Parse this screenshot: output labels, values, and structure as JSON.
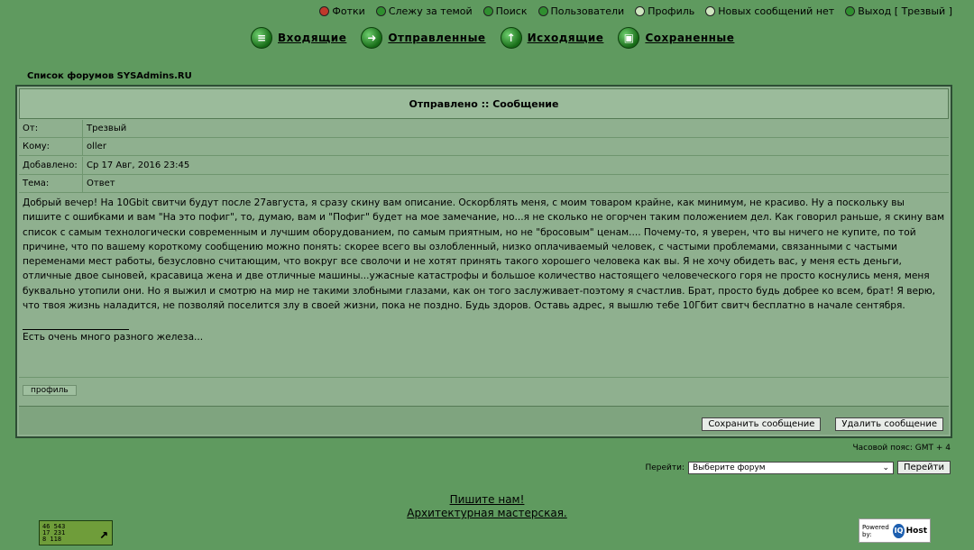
{
  "topnav": [
    {
      "name": "photos",
      "label": "Фотки",
      "color": "red"
    },
    {
      "name": "watched",
      "label": "Слежу за темой",
      "color": "green"
    },
    {
      "name": "search",
      "label": "Поиск",
      "color": "green"
    },
    {
      "name": "users",
      "label": "Пользователи",
      "color": "green"
    },
    {
      "name": "profile",
      "label": "Профиль",
      "color": "lt"
    },
    {
      "name": "new-messages",
      "label": "Новых сообщений нет",
      "color": "lt"
    },
    {
      "name": "logout",
      "label": "Выход [ Трезвый ]",
      "color": "green"
    }
  ],
  "folders": [
    {
      "name": "inbox",
      "label": "Входящие",
      "icon": "≡"
    },
    {
      "name": "sent",
      "label": "Отправленные",
      "icon": "➜"
    },
    {
      "name": "outbox",
      "label": "Исходящие",
      "icon": "↑"
    },
    {
      "name": "saved",
      "label": "Сохраненные",
      "icon": "▣"
    }
  ],
  "forum_list": "Список форумов SYSAdmins.RU",
  "panel_title": "Отправлено :: Сообщение",
  "fields": {
    "from_label": "От:",
    "from": "Трезвый",
    "to_label": "Кому:",
    "to": "oller",
    "date_label": "Добавлено:",
    "date": "Ср 17 Авг, 2016 23:45",
    "subject_label": "Тема:",
    "subject": "Ответ"
  },
  "message": "Добрый вечер! На 10Gbit свитчи будут после 27августа, я сразу скину вам описание. Оскорблять меня, с моим товаром крайне, как минимум, не красиво. Ну а поскольку вы пишите с ошибками и вам \"На это пофиг\", то, думаю, вам и \"Пофиг\" будет на мое замечание, но...я не сколько не огорчен таким положением дел. Как говорил раньше, я скину вам список с самым технологически современным и лучшим оборудованием, по самым приятным, но не \"бросовым\" ценам.... Почему-то, я уверен, что вы ничего не купите, по той причине, что по вашему короткому сообщению можно понять: скорее всего вы озлобленный, низко оплачиваемый человек, с частыми проблемами, связанными с частыми переменами мест работы, безусловно считающим, что вокруг все сволочи и не хотят принять такого хорошего человека как вы. Я не хочу обидеть вас, у меня есть деньги, отличные двое сыновей, красавица жена и две отличные машины...ужасные катастрофы и большое количество настоящего человеческого горя не просто коснулись меня, меня буквально утопили они. Но я выжил и смотрю на мир не такими злобными глазами, как он того заслуживает-поэтому я счастлив. Брат, просто будь добрее ко всем, брат! Я верю, что твоя жизнь наладится, не позволяй поселится злу в своей жизни, пока не поздно. Будь здоров. Оставь адрес, я вышлю тебе 10Гбит свитч бесплатно в начале сентября.",
  "signature": "Есть очень много разного железа...",
  "profile_button": "профиль",
  "save_button": "Сохранить сообщение",
  "delete_button": "Удалить сообщение",
  "timezone": "Часовой пояс: GMT + 4",
  "jump_label": "Перейти:",
  "jump_select": "Выберите форум",
  "jump_button": "Перейти",
  "footer_link1": "Пишите нам!",
  "footer_link2": "Архитектурная мастерская.",
  "counter_lines": [
    "46 543",
    "17 231",
    "8 118"
  ],
  "powered_by": "Powered by:",
  "iq": "IQ",
  "host": "Host"
}
